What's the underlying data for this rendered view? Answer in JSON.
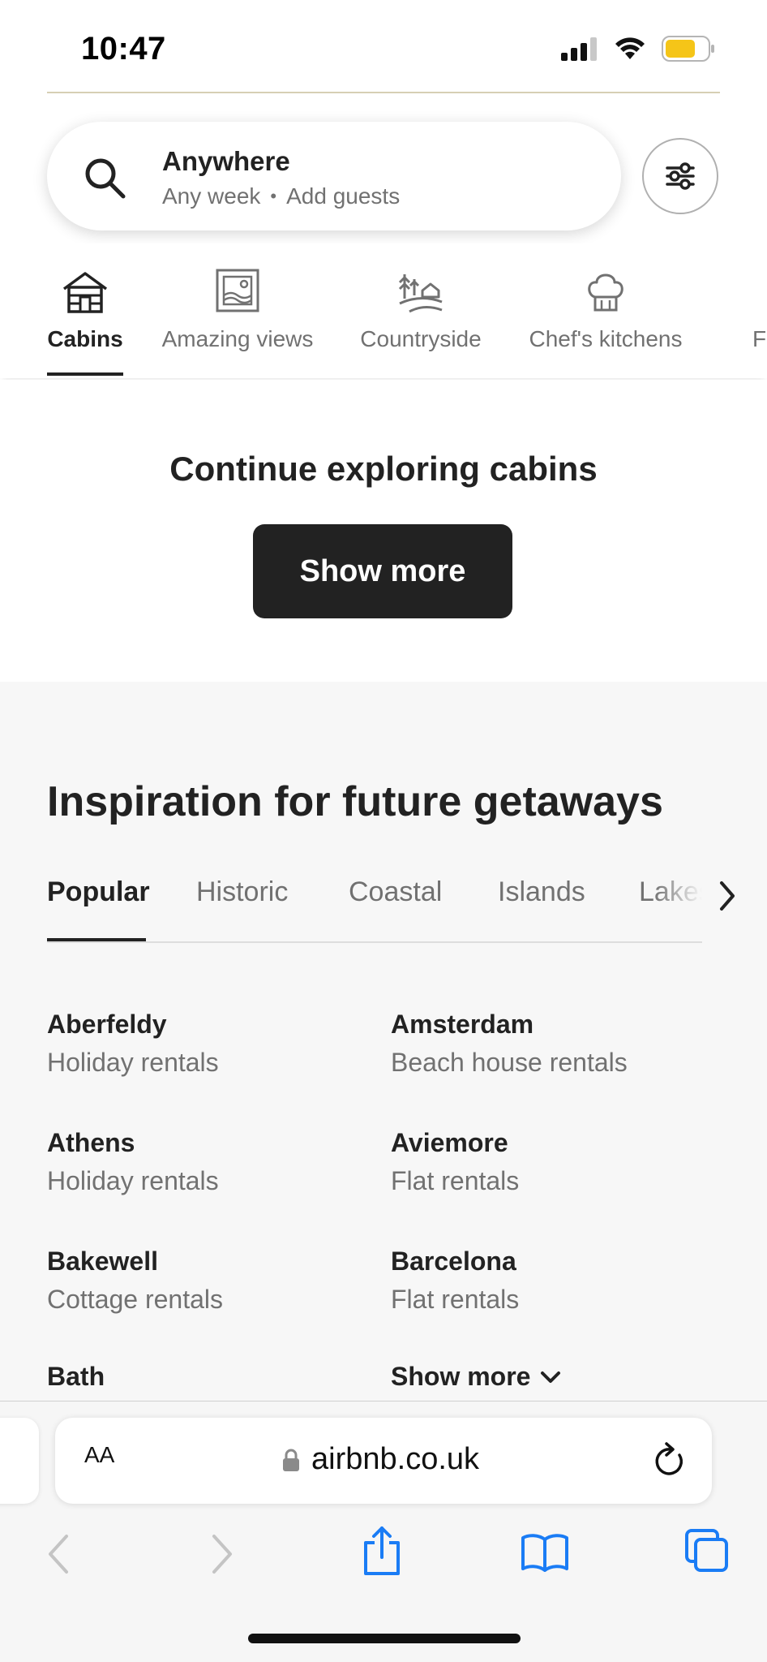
{
  "status_bar": {
    "time": "10:47"
  },
  "search": {
    "title": "Anywhere",
    "when": "Any week",
    "guests": "Add guests"
  },
  "categories": [
    {
      "label": "Cabins",
      "icon": "cabin-icon",
      "active": true
    },
    {
      "label": "Amazing views",
      "icon": "framed-view-icon",
      "active": false
    },
    {
      "label": "Countryside",
      "icon": "countryside-icon",
      "active": false
    },
    {
      "label": "Chef's kitchens",
      "icon": "chef-hat-icon",
      "active": false
    },
    {
      "label": "Fa",
      "icon": "",
      "active": false
    }
  ],
  "continue": {
    "title": "Continue exploring cabins",
    "button": "Show more"
  },
  "inspiration": {
    "title": "Inspiration for future getaways",
    "tabs": [
      "Popular",
      "Historic",
      "Coastal",
      "Islands",
      "Lakes"
    ],
    "active_tab": "Popular",
    "destinations": [
      {
        "name": "Aberfeldy",
        "type": "Holiday rentals"
      },
      {
        "name": "Amsterdam",
        "type": "Beach house rentals"
      },
      {
        "name": "Athens",
        "type": "Holiday rentals"
      },
      {
        "name": "Aviemore",
        "type": "Flat rentals"
      },
      {
        "name": "Bakewell",
        "type": "Cottage rentals"
      },
      {
        "name": "Barcelona",
        "type": "Flat rentals"
      },
      {
        "name": "Bath",
        "type": ""
      }
    ],
    "show_more": "Show more"
  },
  "browser": {
    "text_size": "AA",
    "url": "airbnb.co.uk"
  },
  "colors": {
    "text": "#222222",
    "muted": "#717171",
    "accent_blue": "#1a7cf5",
    "battery": "#f5c518"
  }
}
